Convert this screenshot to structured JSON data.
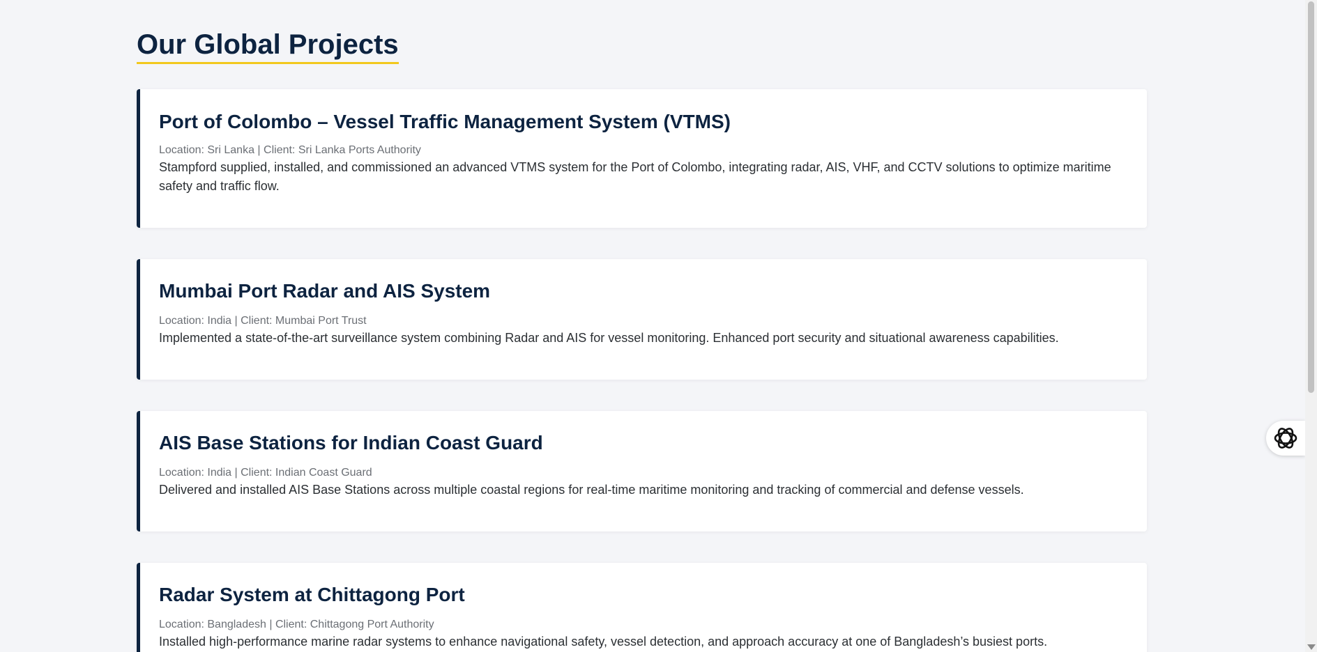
{
  "page": {
    "title": "Our Global Projects"
  },
  "projects": [
    {
      "title": "Port of Colombo – Vessel Traffic Management System (VTMS)",
      "meta": "Location: Sri Lanka | Client: Sri Lanka Ports Authority",
      "description": "Stampford supplied, installed, and commissioned an advanced VTMS system for the Port of Colombo, integrating radar, AIS, VHF, and CCTV solutions to optimize maritime safety and traffic flow."
    },
    {
      "title": "Mumbai Port Radar and AIS System",
      "meta": "Location: India | Client: Mumbai Port Trust",
      "description": "Implemented a state-of-the-art surveillance system combining Radar and AIS for vessel monitoring. Enhanced port security and situational awareness capabilities."
    },
    {
      "title": "AIS Base Stations for Indian Coast Guard",
      "meta": "Location: India | Client: Indian Coast Guard",
      "description": "Delivered and installed AIS Base Stations across multiple coastal regions for real-time maritime monitoring and tracking of commercial and defense vessels."
    },
    {
      "title": "Radar System at Chittagong Port",
      "meta": "Location: Bangladesh | Client: Chittagong Port Authority",
      "description": "Installed high-performance marine radar systems to enhance navigational safety, vessel detection, and approach accuracy at one of Bangladesh’s busiest ports."
    }
  ],
  "widgets": {
    "assistant_icon": "openai-logo-icon"
  },
  "colors": {
    "background": "#f4f5f8",
    "navy": "#0d2340",
    "accent_yellow": "#f2c81e",
    "card": "#ffffff"
  }
}
